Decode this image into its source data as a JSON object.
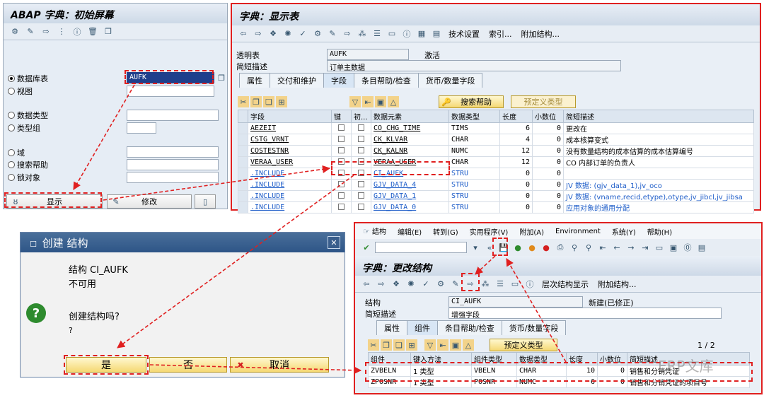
{
  "left_panel": {
    "title": "ABAP 字典：初始屏幕",
    "radios": [
      {
        "label": "数据库表",
        "selected": true
      },
      {
        "label": "视图",
        "selected": false
      },
      {
        "label": "数据类型",
        "selected": false
      },
      {
        "label": "类型组",
        "selected": false
      },
      {
        "label": "域",
        "selected": false
      },
      {
        "label": "搜索帮助",
        "selected": false
      },
      {
        "label": "锁对象",
        "selected": false
      }
    ],
    "table_value": "AUFK",
    "buttons": {
      "display": "显示",
      "change": "修改"
    }
  },
  "right_top": {
    "title": "字典：显示表",
    "toolbar_texts": [
      "技术设置",
      "索引...",
      "附加结构..."
    ],
    "transparent_table_label": "透明表",
    "transparent_table_value": "AUFK",
    "status": "激活",
    "short_desc_label": "简短描述",
    "short_desc_value": "订单主数据",
    "tabs": [
      "属性",
      "交付和维护",
      "字段",
      "条目帮助/检查",
      "货币/数量字段"
    ],
    "search_help_btn": "搜索帮助",
    "predefined_type_btn": "预定义类型",
    "columns": [
      "字段",
      "键",
      "初...",
      "数据元素",
      "数据类型",
      "长度",
      "小数位",
      "简短描述"
    ],
    "rows": [
      {
        "field": "AEZEIT",
        "element": "CO_CHG_TIME",
        "type": "TIMS",
        "len": "6",
        "dec": "0",
        "desc": "更改在"
      },
      {
        "field": "CSTG_VRNT",
        "element": "CK_KLVAR",
        "type": "CHAR",
        "len": "4",
        "dec": "0",
        "desc": "成本核算变式"
      },
      {
        "field": "COSTESTNR",
        "element": "CK_KALNR",
        "type": "NUMC",
        "len": "12",
        "dec": "0",
        "desc": "没有数量结构的成本估算的成本估算编号"
      },
      {
        "field": "VERAA_USER",
        "element": "VERAA_USER",
        "type": "CHAR",
        "len": "12",
        "dec": "0",
        "desc": "CO 内部订单的负责人"
      },
      {
        "field": ".INCLUDE",
        "element": "CI_AUFK",
        "type": "STRU",
        "len": "0",
        "dec": "0",
        "desc": ""
      },
      {
        "field": ".INCLUDE",
        "element": "GJV_DATA_4",
        "type": "STRU",
        "len": "0",
        "dec": "0",
        "desc": "JV 数据: (gjv_data_1),jv_oco"
      },
      {
        "field": ".INCLUDE",
        "element": "GJV_DATA_1",
        "type": "STRU",
        "len": "0",
        "dec": "0",
        "desc": "JV 数据: (vname,recid,etype),otype,jv_jibcl,jv_jibsa"
      },
      {
        "field": ".INCLUDE",
        "element": "GJV_DATA_0",
        "type": "STRU",
        "len": "0",
        "dec": "0",
        "desc": "应用对象的通用分配"
      }
    ]
  },
  "dialog": {
    "title": "创建 结构",
    "line1": "结构 CI_AUFK",
    "line2": "不可用",
    "question": "创建结构吗?",
    "hint": "?",
    "buttons": {
      "yes": "是",
      "no": "否",
      "cancel": "取消"
    }
  },
  "right_bottom": {
    "menu": [
      "结构",
      "编辑(E)",
      "转到(G)",
      "实用程序(V)",
      "附加(A)",
      "Environment",
      "系统(Y)",
      "帮助(H)"
    ],
    "title": "字典：更改结构",
    "toolbar_texts": [
      "层次结构显示",
      "附加结构..."
    ],
    "struct_label": "结构",
    "struct_value": "CI_AUFK",
    "struct_status": "新建(已修正)",
    "short_desc_label": "简短描述",
    "short_desc_value": "增强字段",
    "tabs": [
      "属性",
      "组件",
      "条目帮助/检查",
      "货币/数量字段"
    ],
    "predefined_type_btn": "预定义类型",
    "page": "1 / 2",
    "columns": [
      "组件",
      "键入方法",
      "组件类型",
      "数据类型",
      "长度",
      "小数位",
      "简短描述"
    ],
    "rows": [
      {
        "comp": "ZVBELN",
        "method": "1 类型",
        "ctype": "VBELN",
        "dtype": "CHAR",
        "len": "10",
        "dec": "0",
        "desc": "销售和分销凭证"
      },
      {
        "comp": "ZPOSNR",
        "method": "1 类型",
        "ctype": "POSNR",
        "dtype": "NUMC",
        "len": "6",
        "dec": "0",
        "desc": "销售和分销凭证的项目号"
      }
    ]
  },
  "watermark": "ERP文库"
}
